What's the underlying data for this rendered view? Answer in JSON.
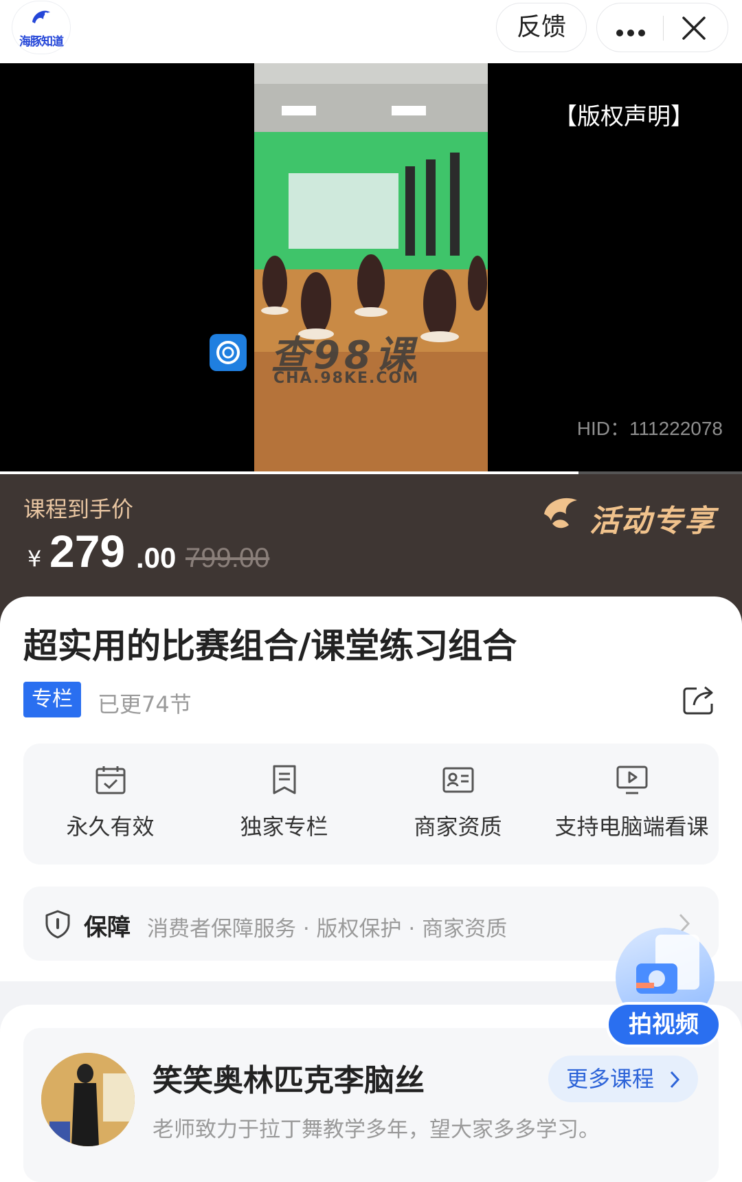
{
  "header": {
    "logo_text": "海豚知道",
    "feedback_label": "反馈"
  },
  "video": {
    "copyright_label": "【版权声明】",
    "hid_text": "HID：111222078",
    "watermark_title": "查98课",
    "watermark_sub": "CHA.98KE.COM",
    "progress": 0.78
  },
  "price": {
    "label": "课程到手价",
    "currency": "¥",
    "integer": "279",
    "decimal": ".00",
    "original": "799.00",
    "activity_label": "活动专享"
  },
  "course": {
    "title": "超实用的比赛组合/课堂练习组合",
    "tag": "专栏",
    "updated": "已更74节",
    "features": [
      {
        "label": "永久有效",
        "icon": "calendar-check-icon"
      },
      {
        "label": "独家专栏",
        "icon": "bookmark-icon"
      },
      {
        "label": "商家资质",
        "icon": "id-card-icon"
      },
      {
        "label": "支持电脑端看课",
        "icon": "monitor-play-icon"
      }
    ],
    "guarantee": {
      "title": "保障",
      "items": "消费者保障服务 · 版权保护 · 商家资质"
    }
  },
  "teacher": {
    "name": "笑笑奥林匹克李脑丝",
    "description": "老师致力于拉丁舞教学多年，望大家多多学习。",
    "more_label": "更多课程"
  },
  "fab": {
    "label": "拍视频"
  },
  "colors": {
    "brand_blue": "#2a6ff0",
    "price_band": "#3e3633",
    "gold": "#f0c28c"
  }
}
